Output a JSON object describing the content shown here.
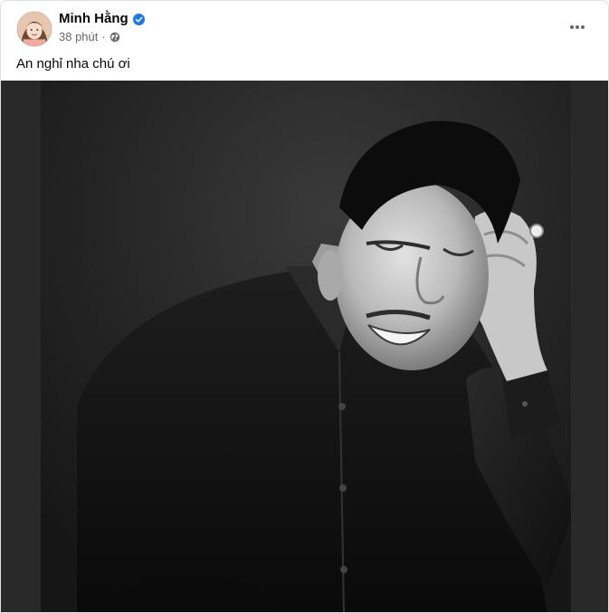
{
  "post": {
    "author": {
      "name": "Minh Hằng",
      "verified_icon": "verified-badge-icon",
      "avatar_icon": "avatar"
    },
    "meta": {
      "time": "38 phút",
      "separator": "·",
      "audience_icon": "globe-icon"
    },
    "more_icon": "more-options-icon",
    "caption": "An nghỉ nha chú ơi",
    "photo": {
      "description_icon": "photo"
    }
  },
  "colors": {
    "text_primary": "#050505",
    "text_secondary": "#65676b",
    "verified_blue": "#1877f2",
    "photo_backdrop": "#292929"
  }
}
